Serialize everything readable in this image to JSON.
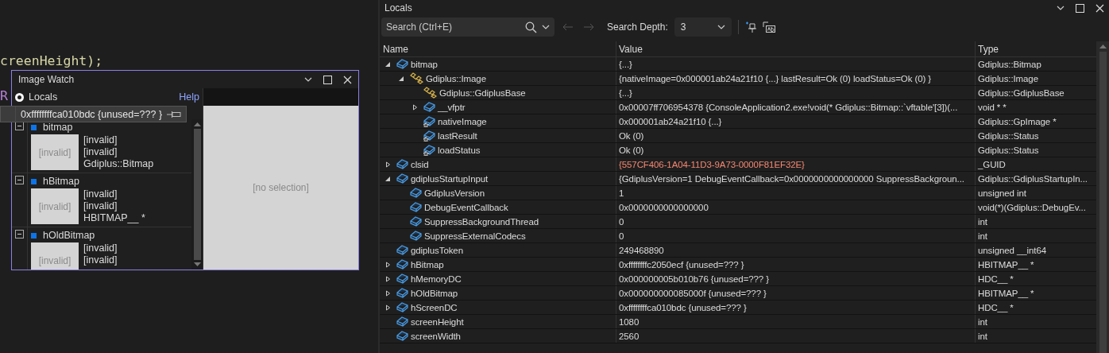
{
  "editor": {
    "lines": [
      {
        "text": "creenHeight);",
        "color": "#d7d7a8"
      },
      {
        "text": "R",
        "color": "#b77fd8"
      }
    ]
  },
  "image_watch": {
    "title": "Image Watch",
    "source": {
      "label": "Locals",
      "selected": true
    },
    "help": "Help",
    "empty_text": "[no selection]",
    "items": [
      {
        "name": "bitmap",
        "expanded": true,
        "thumbnail": "[invalid]",
        "lines": [
          "[invalid]",
          "[invalid]",
          "Gdiplus::Bitmap"
        ]
      },
      {
        "name": "hBitmap",
        "expanded": true,
        "thumbnail": "[invalid]",
        "lines": [
          "[invalid]",
          "[invalid]",
          "HBITMAP__ *"
        ]
      },
      {
        "name": "hOldBitmap",
        "expanded": true,
        "thumbnail": "[invalid]",
        "lines": [
          "[invalid]",
          "[invalid]"
        ]
      }
    ]
  },
  "tooltip": {
    "text": "0xffffffffca010bdc {unused=??? }"
  },
  "locals": {
    "title": "Locals",
    "search": {
      "placeholder": "Search (Ctrl+E)"
    },
    "depth_label": "Search Depth:",
    "depth_value": "3",
    "columns": [
      "Name",
      "Value",
      "Type"
    ],
    "rows": [
      {
        "name": "bitmap",
        "kind": "field",
        "expanded": true,
        "value": "{...}",
        "type": "Gdiplus::Bitmap",
        "changed": false,
        "children": [
          {
            "name": "Gdiplus::Image",
            "kind": "base",
            "expanded": true,
            "value": "{nativeImage=0x000001ab24a21f10 {...} lastResult=Ok (0) loadStatus=Ok (0) }",
            "type": "Gdiplus::Image",
            "changed": false,
            "children": [
              {
                "name": "Gdiplus::GdiplusBase",
                "kind": "base",
                "value": "{...}",
                "type": "Gdiplus::GdiplusBase",
                "changed": false
              },
              {
                "name": "__vfptr",
                "kind": "field",
                "expanded": false,
                "value": "0x00007ff706954378 {ConsoleApplication2.exe!void(* Gdiplus::Bitmap::`vftable'[3])(...",
                "type": "void * *",
                "changed": false
              },
              {
                "name": "nativeImage",
                "kind": "member",
                "value": "0x000001ab24a21f10 {...}",
                "type": "Gdiplus::GpImage *",
                "changed": false
              },
              {
                "name": "lastResult",
                "kind": "member",
                "value": "Ok (0)",
                "type": "Gdiplus::Status",
                "changed": false
              },
              {
                "name": "loadStatus",
                "kind": "member",
                "value": "Ok (0)",
                "type": "Gdiplus::Status",
                "changed": false
              }
            ]
          }
        ]
      },
      {
        "name": "clsid",
        "kind": "field",
        "expanded": false,
        "value": "{557CF406-1A04-11D3-9A73-0000F81EF32E}",
        "type": "_GUID",
        "changed": true
      },
      {
        "name": "gdiplusStartupInput",
        "kind": "field",
        "expanded": true,
        "value": "{GdiplusVersion=1 DebugEventCallback=0x0000000000000000 SuppressBackgroun...",
        "type": "Gdiplus::GdiplusStartupIn...",
        "changed": false,
        "children": [
          {
            "name": "GdiplusVersion",
            "kind": "field",
            "value": "1",
            "type": "unsigned int",
            "changed": false
          },
          {
            "name": "DebugEventCallback",
            "kind": "field",
            "value": "0x0000000000000000",
            "type": "void(*)(Gdiplus::DebugEv...",
            "changed": false
          },
          {
            "name": "SuppressBackgroundThread",
            "kind": "field",
            "value": "0",
            "type": "int",
            "changed": false
          },
          {
            "name": "SuppressExternalCodecs",
            "kind": "field",
            "value": "0",
            "type": "int",
            "changed": false
          }
        ]
      },
      {
        "name": "gdiplusToken",
        "kind": "field",
        "value": "249468890",
        "type": "unsigned __int64",
        "changed": false
      },
      {
        "name": "hBitmap",
        "kind": "field",
        "expanded": false,
        "value": "0xffffffffc2050ecf {unused=??? }",
        "type": "HBITMAP__ *",
        "changed": false
      },
      {
        "name": "hMemoryDC",
        "kind": "field",
        "expanded": false,
        "value": "0x000000005b010b76 {unused=??? }",
        "type": "HDC__ *",
        "changed": false
      },
      {
        "name": "hOldBitmap",
        "kind": "field",
        "expanded": false,
        "value": "0x000000000085000f {unused=??? }",
        "type": "HBITMAP__ *",
        "changed": false
      },
      {
        "name": "hScreenDC",
        "kind": "field",
        "expanded": false,
        "value": "0xffffffffca010bdc {unused=??? }",
        "type": "HDC__ *",
        "changed": false
      },
      {
        "name": "screenHeight",
        "kind": "field",
        "value": "1080",
        "type": "int",
        "changed": false
      },
      {
        "name": "screenWidth",
        "kind": "field",
        "value": "2560",
        "type": "int",
        "changed": false
      }
    ]
  }
}
